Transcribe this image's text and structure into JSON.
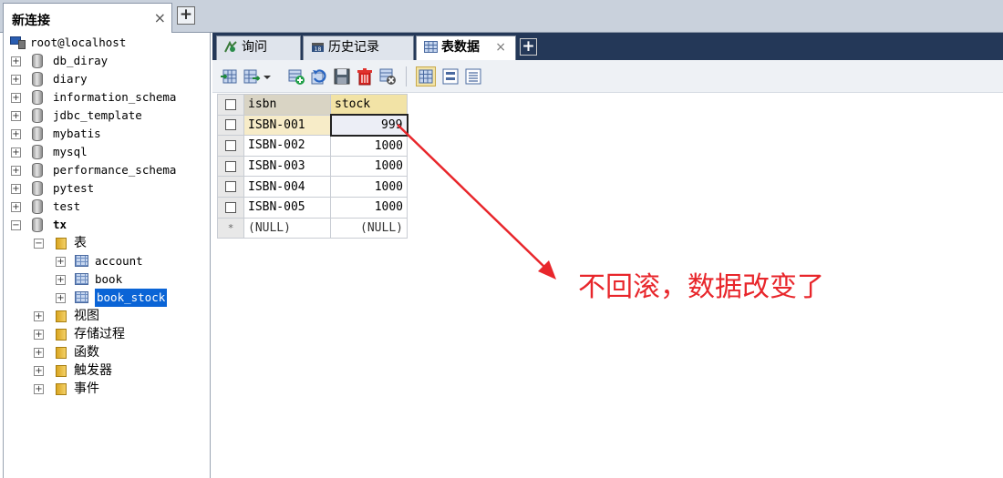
{
  "connection_tab": {
    "title": "新连接",
    "close": "×",
    "add": "+"
  },
  "tree": {
    "root": "root@localhost",
    "databases": [
      "db_diray",
      "diary",
      "information_schema",
      "jdbc_template",
      "mybatis",
      "mysql",
      "performance_schema",
      "pytest",
      "test",
      "tx"
    ],
    "expanded_db": "tx",
    "tables_folder": "表",
    "tables": [
      "account",
      "book",
      "book_stock"
    ],
    "selected_table": "book_stock",
    "other_folders": [
      "视图",
      "存储过程",
      "函数",
      "触发器",
      "事件"
    ],
    "expand_plus": "+",
    "expand_minus": "−"
  },
  "subtabs": [
    {
      "label": "询问",
      "icon": "query-icon"
    },
    {
      "label": "历史记录",
      "icon": "history-icon"
    },
    {
      "label": "表数据",
      "icon": "table-data-icon",
      "active": true
    }
  ],
  "subtab_close": "×",
  "subtab_add": "+",
  "grid": {
    "columns": [
      "isbn",
      "stock"
    ],
    "rows": [
      {
        "isbn": "ISBN-001",
        "stock": "999"
      },
      {
        "isbn": "ISBN-002",
        "stock": "1000"
      },
      {
        "isbn": "ISBN-003",
        "stock": "1000"
      },
      {
        "isbn": "ISBN-004",
        "stock": "1000"
      },
      {
        "isbn": "ISBN-005",
        "stock": "1000"
      }
    ],
    "new_row": {
      "marker": "*",
      "isbn": "(NULL)",
      "stock": "(NULL)"
    }
  },
  "annotation": {
    "text": "不回滚，数据改变了",
    "color": "#e8262b"
  }
}
